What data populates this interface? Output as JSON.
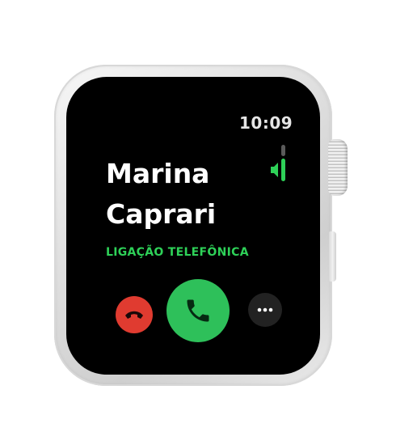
{
  "status": {
    "time": "10:09"
  },
  "call": {
    "contact_name": "Marina Caprari",
    "call_type": "LIGAÇÃO TELEFÔNICA"
  },
  "buttons": {
    "decline": {
      "icon": "phone-hangup-icon",
      "color": "#e03b30"
    },
    "accept": {
      "icon": "phone-icon",
      "color": "#2ec05a"
    },
    "more": {
      "icon": "ellipsis-icon",
      "color": "#222222"
    }
  },
  "colors": {
    "accent_green": "#2ed158",
    "screen_bg": "#000000"
  }
}
